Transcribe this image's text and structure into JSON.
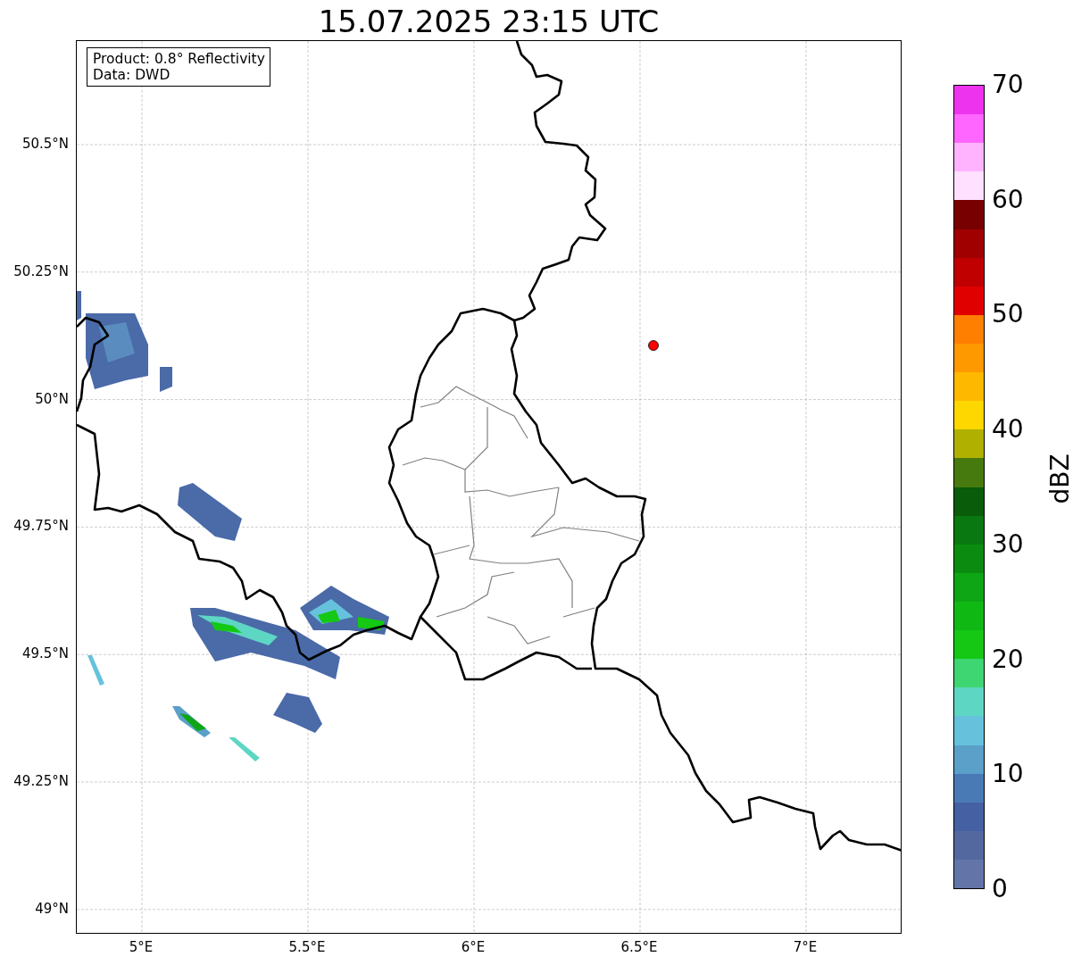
{
  "title": "15.07.2025 23:15 UTC",
  "info_box": {
    "lines": [
      "Product: 0.8° Reflectivity",
      "Data: DWD"
    ]
  },
  "y_ticks": [
    "50.5°N",
    "50.25°N",
    "50°N",
    "49.75°N",
    "49.5°N",
    "49.25°N",
    "49°N"
  ],
  "x_ticks": [
    "5°E",
    "5.5°E",
    "6°E",
    "6.5°E",
    "7°E"
  ],
  "colorbar": {
    "label": "dBZ",
    "ticks": [
      "70",
      "60",
      "50",
      "40",
      "30",
      "20",
      "10",
      "0"
    ],
    "segments": [
      {
        "color": "#ee33ee"
      },
      {
        "color": "#ff66ff"
      },
      {
        "color": "#ffb3ff"
      },
      {
        "color": "#ffe0ff"
      },
      {
        "color": "#780000"
      },
      {
        "color": "#a00000"
      },
      {
        "color": "#c00000"
      },
      {
        "color": "#e00000"
      },
      {
        "color": "#ff7f00"
      },
      {
        "color": "#ff9900"
      },
      {
        "color": "#ffb800"
      },
      {
        "color": "#ffd700"
      },
      {
        "color": "#b0b000"
      },
      {
        "color": "#467a0e"
      },
      {
        "color": "#085c0a"
      },
      {
        "color": "#0a7810"
      },
      {
        "color": "#0b8c10"
      },
      {
        "color": "#0ea614"
      },
      {
        "color": "#10b814"
      },
      {
        "color": "#14c814"
      },
      {
        "color": "#3ed672"
      },
      {
        "color": "#5ed6c4"
      },
      {
        "color": "#66c2dc"
      },
      {
        "color": "#5aa0c8"
      },
      {
        "color": "#4a7ab5"
      },
      {
        "color": "#4560a3"
      },
      {
        "color": "#5468a0"
      },
      {
        "color": "#6374a8"
      }
    ]
  }
}
